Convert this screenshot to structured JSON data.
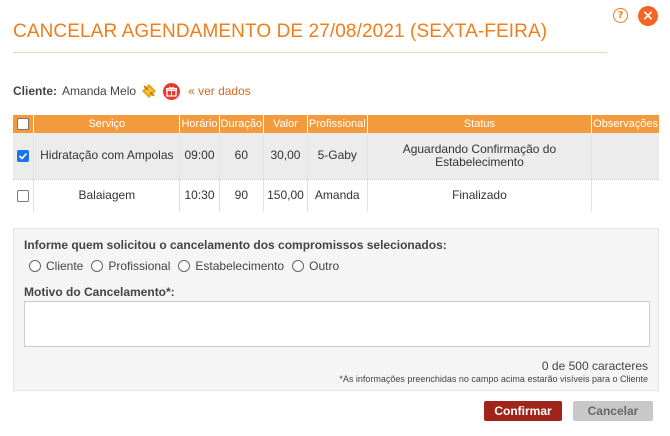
{
  "header": {
    "title": "CANCELAR AGENDAMENTO DE 27/08/2021 (SEXTA-FEIRA)",
    "help_glyph": "?",
    "close_glyph": "×"
  },
  "client": {
    "label": "Cliente:",
    "name": "Amanda Melo",
    "view_link": "« ver dados"
  },
  "table": {
    "columns": [
      "Serviço",
      "Horário",
      "Duração",
      "Valor",
      "Profissional",
      "Status",
      "Observações"
    ],
    "rows": [
      {
        "checked": true,
        "service": "Hidratação com Ampolas",
        "time": "09:00",
        "duration": "60",
        "value": "30,00",
        "professional": "5-Gaby",
        "status": "Aguardando Confirmação do Estabelecimento",
        "notes": ""
      },
      {
        "checked": false,
        "service": "Balaiagem",
        "time": "10:30",
        "duration": "90",
        "value": "150,00",
        "professional": "Amanda",
        "status": "Finalizado",
        "notes": ""
      }
    ]
  },
  "cancellation": {
    "question": "Informe quem solicitou o cancelamento dos compromissos selecionados:",
    "options": [
      "Cliente",
      "Profissional",
      "Estabelecimento",
      "Outro"
    ],
    "reason_label": "Motivo do Cancelamento*:",
    "reason_value": "",
    "char_count": "0 de 500 caracteres",
    "note": "*As informações preenchidas no campo acima estarão visíveis para o Cliente"
  },
  "actions": {
    "confirm": "Confirmar",
    "cancel": "Cancelar"
  },
  "colors": {
    "accent": "#f07d1a",
    "table_header": "#f39a3d",
    "confirm_button": "#a1241b",
    "cancel_button": "#c8c8c8",
    "close_button": "#f26522"
  }
}
